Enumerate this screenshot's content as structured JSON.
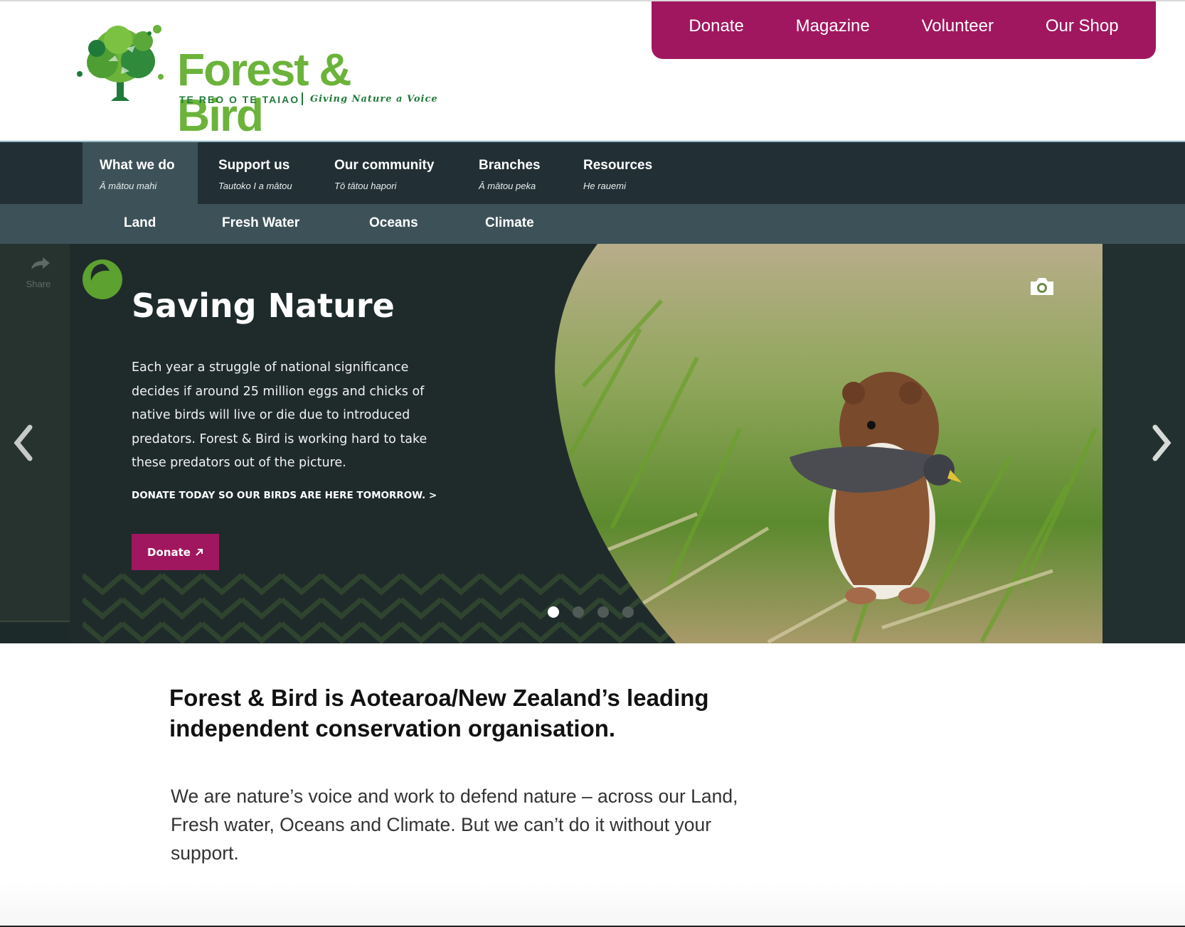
{
  "brand": {
    "name": "Forest & Bird",
    "tagline_maori": "TE REO O TE TAIAO",
    "tagline_english": "Giving Nature a Voice"
  },
  "utility_nav": [
    "Donate",
    "Magazine",
    "Volunteer",
    "Our Shop"
  ],
  "main_nav": [
    {
      "title": "What we do",
      "subtitle": "Ā mātou mahi",
      "active": true
    },
    {
      "title": "Support us",
      "subtitle": "Tautoko I a mātou"
    },
    {
      "title": "Our community",
      "subtitle": "Tō tātou hapori"
    },
    {
      "title": "Branches",
      "subtitle": "Ā mātou peka"
    },
    {
      "title": "Resources",
      "subtitle": "He rauemi"
    }
  ],
  "sub_nav": [
    "Land",
    "Fresh Water",
    "Oceans",
    "Climate"
  ],
  "hero": {
    "title": "Saving Nature",
    "description": "Each year a struggle of national significance decides if around 25 million eggs and chicks of native birds will live or die due to introduced predators. Forest & Bird is working hard to take these predators out of the picture.",
    "cta_link": "DONATE TODAY SO OUR BIRDS ARE HERE TOMORROW. >",
    "donate_button": "Donate",
    "share_label": "Share",
    "slide_count": 4,
    "active_slide": 1
  },
  "intro": {
    "title": "Forest & Bird is Aotearoa/New Zealand’s leading independent conservation organisation.",
    "body": "We are nature’s voice and work to defend nature – across our Land, Fresh water, Oceans and Climate. But we can’t do it without your support."
  },
  "colors": {
    "brand_green": "#6bb33a",
    "dark_green": "#1f7a3a",
    "magenta": "#a1175f",
    "nav_dark": "#223035",
    "nav_mid": "#3d5258",
    "hero_bg": "#1f2b2b"
  },
  "icons": [
    "tree-logo-icon",
    "swirl-icon",
    "share-icon",
    "camera-icon",
    "chevron-left-icon",
    "chevron-right-icon",
    "external-arrow-icon"
  ]
}
